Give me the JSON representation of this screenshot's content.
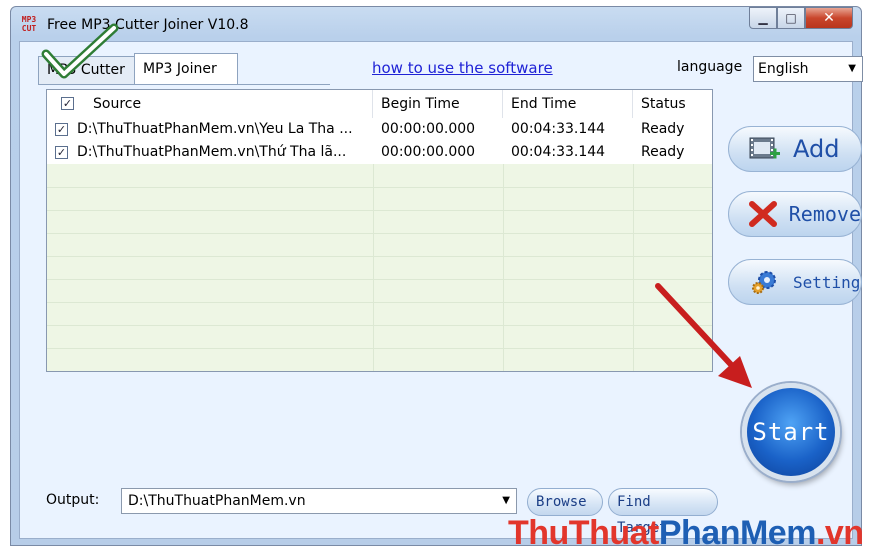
{
  "window": {
    "title": "Free MP3 Cutter Joiner V10.8",
    "app_icon_text": "MP3\nCUT",
    "min_glyph": "▁",
    "max_glyph": "□",
    "close_glyph": "✕"
  },
  "tabs": [
    {
      "label": "MP3 Cutter"
    },
    {
      "label": "MP3 Joiner"
    }
  ],
  "help_link": "how to use the software",
  "language": {
    "label": "language",
    "value": "English"
  },
  "table": {
    "columns": [
      "Source",
      "Begin Time",
      "End Time",
      "Status"
    ],
    "rows": [
      {
        "source": "D:\\ThuThuatPhanMem.vn\\Yeu La Tha ...",
        "begin": "00:00:00.000",
        "end": "00:04:33.144",
        "status": "Ready",
        "checked": true
      },
      {
        "source": "D:\\ThuThuatPhanMem.vn\\Thứ Tha lã...",
        "begin": "00:00:00.000",
        "end": "00:04:33.144",
        "status": "Ready",
        "checked": true
      }
    ]
  },
  "buttons": {
    "add": "Add",
    "remove": "Remove",
    "setting": "Setting",
    "start": "Start",
    "browse": "Browse",
    "find_target": "Find Target"
  },
  "output": {
    "label": "Output:",
    "value": "D:\\ThuThuatPhanMem.vn"
  },
  "watermark": {
    "part1": "ThuThuat",
    "part2": "PhanMem",
    "part3": ".vn"
  },
  "colors": {
    "accent": "#1f4fa7",
    "link": "#1f22d6",
    "annotation_red": "#c81e1e",
    "watermark_red": "#e2362c",
    "watermark_blue": "#1e5fb4"
  }
}
